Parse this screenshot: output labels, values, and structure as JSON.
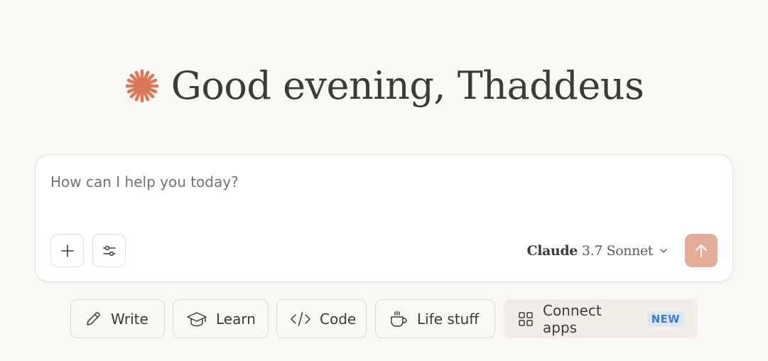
{
  "greeting": {
    "text": "Good evening, Thaddeus"
  },
  "composer": {
    "placeholder": "How can I help you today?",
    "model": {
      "name": "Claude",
      "version": "3.7 Sonnet"
    }
  },
  "chips": {
    "write": "Write",
    "learn": "Learn",
    "code": "Code",
    "life": "Life stuff",
    "connect": "Connect apps",
    "connect_badge": "NEW"
  },
  "colors": {
    "background": "#f9f8f5",
    "accent": "#d97757",
    "send_button": "#e4ad9a",
    "badge_text": "#3a7bd5"
  },
  "icons": {
    "logo": "claude-spark-icon",
    "plus": "plus-icon",
    "tools": "sliders-icon",
    "chevron": "chevron-down-icon",
    "send": "arrow-up-icon",
    "write": "pencil-icon",
    "learn": "graduation-cap-icon",
    "code": "code-brackets-icon",
    "life": "coffee-cup-icon",
    "connect": "grid-apps-icon"
  }
}
